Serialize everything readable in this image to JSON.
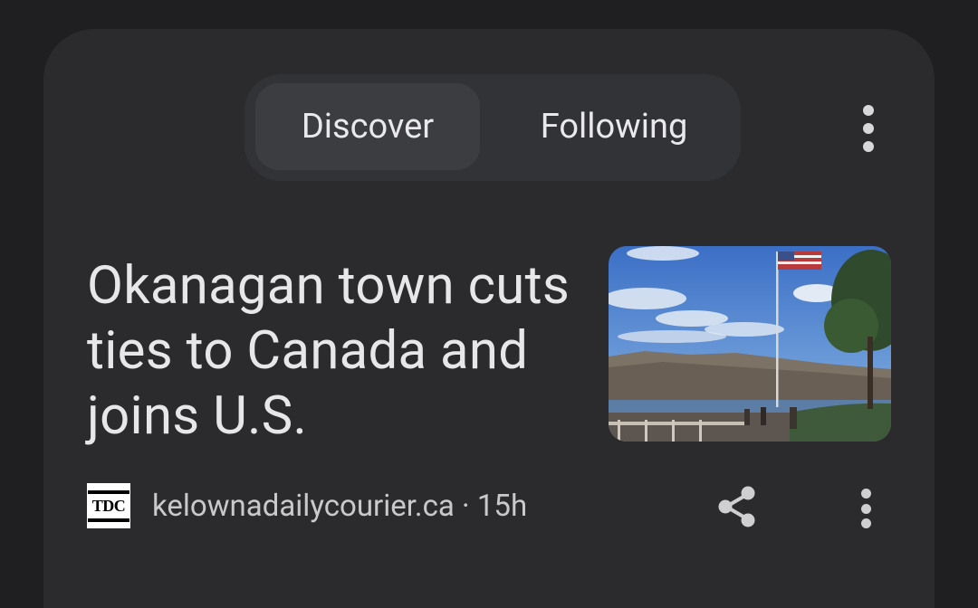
{
  "tabs": {
    "discover_label": "Discover",
    "following_label": "Following",
    "active": "Discover"
  },
  "article": {
    "headline": "Okanagan town cuts ties to Canada and joins U.S.",
    "source_logo_text": "TDC",
    "source": "kelownadailycourier.ca",
    "separator": " · ",
    "age": "15h",
    "thumbnail_icon": "flag-lake-photo"
  },
  "icons": {
    "top_menu": "more-vert-icon",
    "share": "share-icon",
    "item_menu": "more-vert-icon"
  },
  "colors": {
    "background": "#1f1f21",
    "card": "#2b2b2e",
    "tab_active": "#3c3d41",
    "text_primary": "#e7e7e9",
    "text_secondary": "#c9c9cc"
  }
}
